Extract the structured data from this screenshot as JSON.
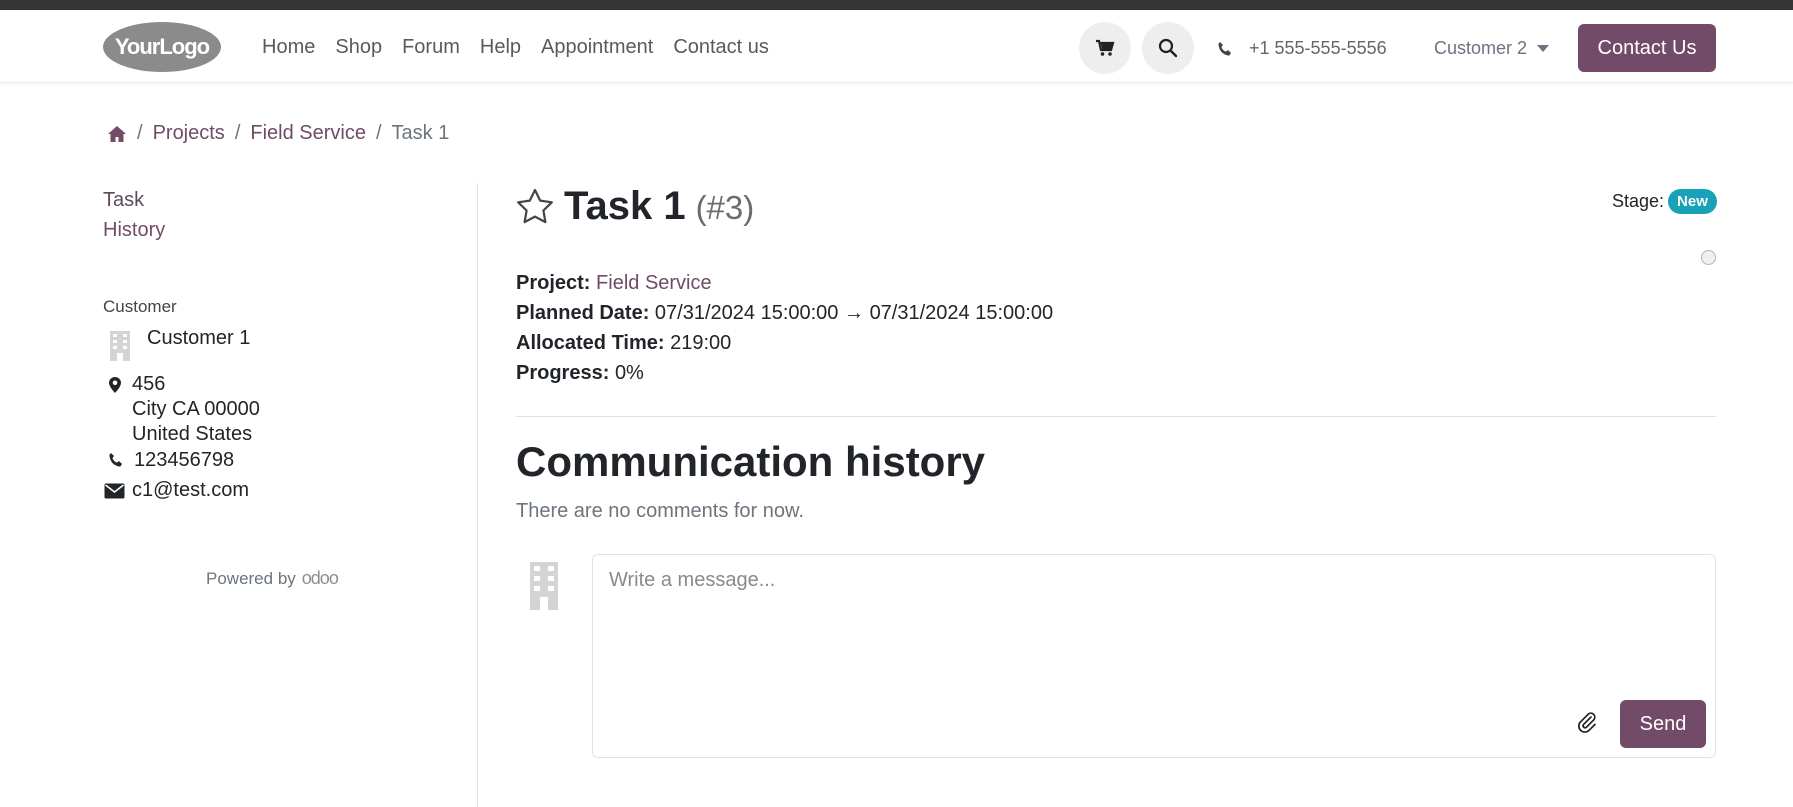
{
  "header": {
    "logo_text": "YourLogo",
    "nav": [
      "Home",
      "Shop",
      "Forum",
      "Help",
      "Appointment",
      "Contact us"
    ],
    "phone": "+1 555-555-5556",
    "user": "Customer 2",
    "contact_button": "Contact Us",
    "icons": {
      "cart": "cart-icon",
      "search": "search-icon",
      "phone": "phone-icon"
    }
  },
  "breadcrumb": {
    "home_icon": "home-icon",
    "items": [
      "Projects",
      "Field Service"
    ],
    "current": "Task 1"
  },
  "sidebar": {
    "links": [
      "Task",
      "History"
    ],
    "customer_label": "Customer",
    "customer_name": "Customer 1",
    "address_line1": "456",
    "address_line2": "City CA 00000",
    "address_line3": "United States",
    "phone": "123456798",
    "email": "c1@test.com",
    "powered_by": "Powered by",
    "powered_brand": "odoo"
  },
  "task": {
    "title": "Task 1",
    "ref": "(#3)",
    "stage_label": "Stage:",
    "stage": "New",
    "project_label": "Project:",
    "project": "Field Service",
    "planned_label": "Planned Date:",
    "planned_start": "07/31/2024 15:00:00",
    "planned_arrow": "→",
    "planned_end": "07/31/2024 15:00:00",
    "allocated_label": "Allocated Time:",
    "allocated": "219:00",
    "progress_label": "Progress:",
    "progress": "0%"
  },
  "communication": {
    "title": "Communication history",
    "empty": "There are no comments for now.",
    "placeholder": "Write a message...",
    "send": "Send"
  },
  "colors": {
    "primary": "#714b67",
    "badge": "#17a2b8",
    "topstrip": "#343434"
  }
}
